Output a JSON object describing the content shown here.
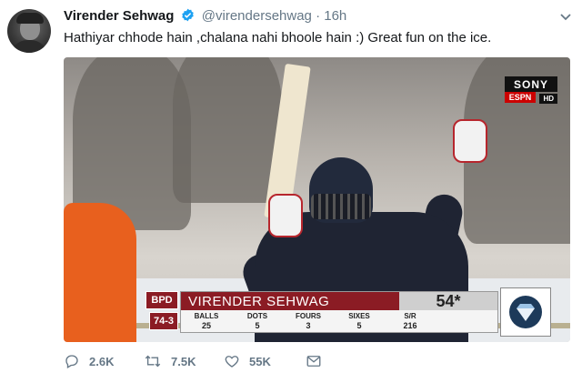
{
  "tweet": {
    "author_name": "Virender Sehwag",
    "handle": "@virendersehwag",
    "separator": "·",
    "time": "16h",
    "text": "Hathiyar chhode hain ,chalana nahi bhoole hain :) Great fun on the ice."
  },
  "media": {
    "broadcaster": {
      "brand": "SONY",
      "channel": "ESPN",
      "hd": "HD"
    },
    "scoreboard": {
      "team": "BPD",
      "team_score": "74-3",
      "batsman": "VIRENDER SEHWAG",
      "runs": "54*",
      "stat_labels": [
        "BALLS",
        "DOTS",
        "FOURS",
        "SIXES",
        "S/R"
      ],
      "stat_values": [
        "25",
        "5",
        "3",
        "5",
        "216"
      ]
    }
  },
  "actions": {
    "replies": "2.6K",
    "retweets": "7.5K",
    "likes": "55K"
  },
  "colors": {
    "verified": "#1da1f2",
    "muted": "#657786",
    "scoreboard_red": "#8b1c24"
  }
}
